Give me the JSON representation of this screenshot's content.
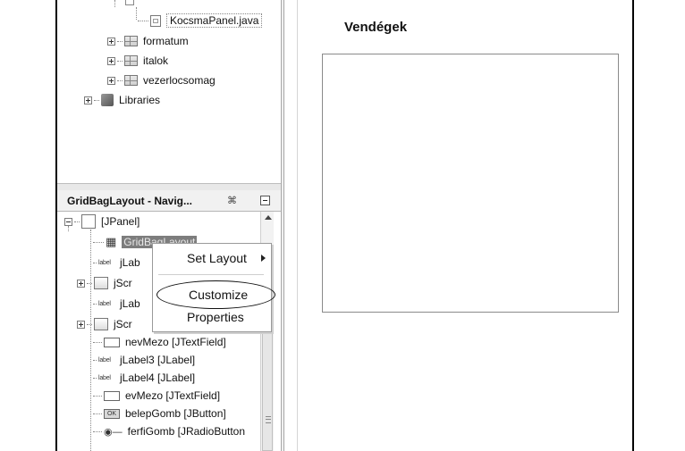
{
  "project_tree": {
    "items": [
      {
        "label": "KocsmaPanel.java",
        "icon": "java-file-icon"
      },
      {
        "label": "formatum",
        "icon": "package-icon"
      },
      {
        "label": "italok",
        "icon": "package-icon"
      },
      {
        "label": "vezerlocsomag",
        "icon": "package-icon"
      },
      {
        "label": "Libraries",
        "icon": "libraries-icon"
      }
    ]
  },
  "navigator": {
    "title": "GridBagLayout - Navig...",
    "close_symbol": "⌘",
    "tree": [
      {
        "label": "[JPanel]",
        "icon": "panel-icon"
      },
      {
        "label": "GridBagLayout",
        "icon": "gridbag-icon"
      },
      {
        "label": "jLab",
        "icon": "label-icon"
      },
      {
        "label": "jScr",
        "icon": "scrollpane-icon"
      },
      {
        "label": "jLab",
        "icon": "label-icon"
      },
      {
        "label": "jScr",
        "icon": "scrollpane-icon"
      },
      {
        "label": "nevMezo [JTextField]",
        "icon": "textfield-icon"
      },
      {
        "label": "jLabel3 [JLabel]",
        "icon": "label-icon"
      },
      {
        "label": "jLabel4 [JLabel]",
        "icon": "label-icon"
      },
      {
        "label": "evMezo [JTextField]",
        "icon": "textfield-icon"
      },
      {
        "label": "belepGomb [JButton]",
        "icon": "button-icon"
      },
      {
        "label": "ferfiGomb [JRadioButton",
        "icon": "radiobutton-icon"
      }
    ],
    "label_icon_text": "label",
    "ok_icon_text": "OK"
  },
  "context_menu": {
    "items": [
      {
        "label": "Set Layout"
      },
      {
        "label": "Customize"
      },
      {
        "label": "Properties"
      }
    ]
  },
  "form": {
    "title": "Vendégek"
  }
}
